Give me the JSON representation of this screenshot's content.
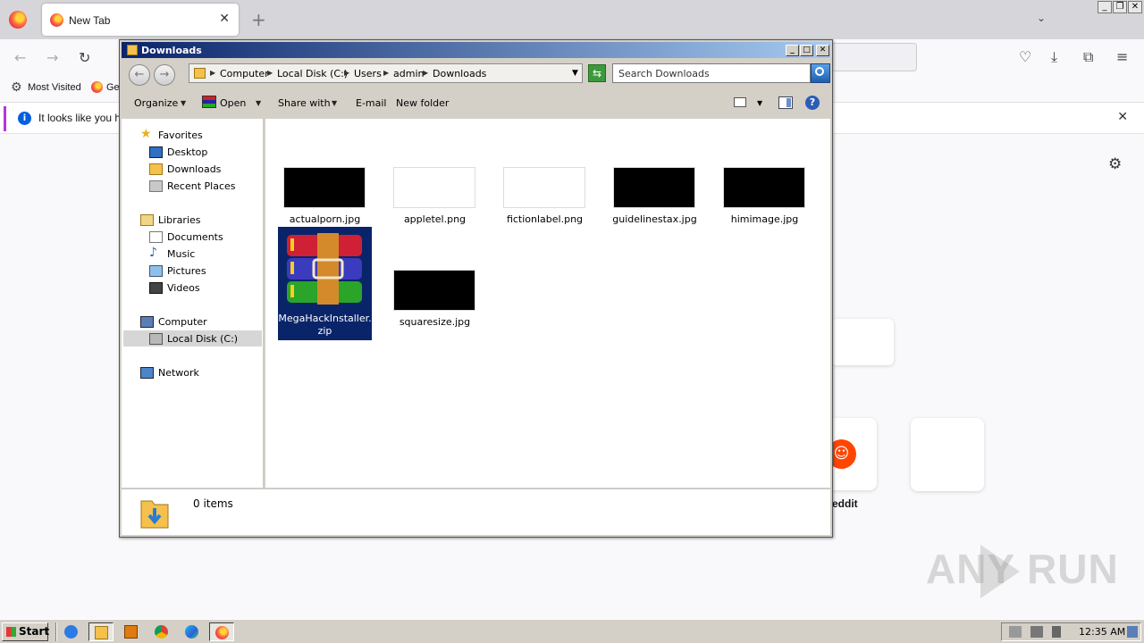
{
  "firefox": {
    "tab_title": "New Tab",
    "tab_close": "✕",
    "new_tab": "+",
    "bookmarks": {
      "most_visited": "Most Visited",
      "getting_started": "Ge"
    },
    "notice": "It looks like you ha",
    "notice_close": "✕",
    "shortcut_label": "eddit",
    "window_controls": [
      "_",
      "❐",
      "✕"
    ]
  },
  "explorer": {
    "title": "Downloads",
    "title_controls": [
      "_",
      "□",
      "✕"
    ],
    "breadcrumb": [
      "Computer",
      "Local Disk (C:)",
      "Users",
      "admin",
      "Downloads"
    ],
    "search_placeholder": "Search Downloads",
    "commands": {
      "organize": "Organize",
      "open": "Open",
      "share_with": "Share with",
      "email": "E-mail",
      "new_folder": "New folder",
      "help": "?"
    },
    "nav": {
      "favorites": "Favorites",
      "desktop": "Desktop",
      "downloads": "Downloads",
      "recent_places": "Recent Places",
      "libraries": "Libraries",
      "documents": "Documents",
      "music": "Music",
      "pictures": "Pictures",
      "videos": "Videos",
      "computer": "Computer",
      "local_disk": "Local Disk (C:)",
      "network": "Network"
    },
    "files": [
      {
        "name": "actualporn.jpg",
        "thumb": "black"
      },
      {
        "name": "appletel.png",
        "thumb": "white"
      },
      {
        "name": "fictionlabel.png",
        "thumb": "white"
      },
      {
        "name": "guidelinestax.jpg",
        "thumb": "black"
      },
      {
        "name": "himimage.jpg",
        "thumb": "black"
      },
      {
        "name": "MegaHackInstaller.zip",
        "thumb": "winrar",
        "selected": true
      },
      {
        "name": "squaresize.jpg",
        "thumb": "black"
      }
    ],
    "status": "0 items"
  },
  "taskbar": {
    "start": "Start",
    "clock": "12:35 AM"
  },
  "watermark": "ANY RUN",
  "colors": {
    "title_gradient_start": "#0a246a",
    "title_gradient_end": "#a6caf0",
    "selection": "#0a246a",
    "classic_face": "#d4d0c8"
  }
}
